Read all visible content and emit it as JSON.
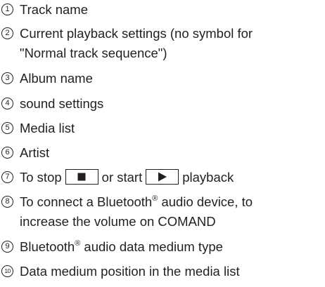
{
  "items": [
    {
      "number": "1",
      "text": "Track name"
    },
    {
      "number": "2",
      "line1": "Current playback settings (no symbol for",
      "line2": "\"Normal track sequence\")"
    },
    {
      "number": "3",
      "text": "Album name"
    },
    {
      "number": "4",
      "text": "sound settings"
    },
    {
      "number": "5",
      "text": "Media list"
    },
    {
      "number": "6",
      "text": "Artist"
    },
    {
      "number": "7",
      "part1": "To stop",
      "part2": "or start",
      "part3": "playback",
      "stop_icon": "stop-square-icon",
      "play_icon": "play-triangle-icon"
    },
    {
      "number": "8",
      "line1_a": "To connect a Bluetooth",
      "registered": "®",
      "line1_b": " audio device, to",
      "line2": "increase the volume on COMAND"
    },
    {
      "number": "9",
      "text_a": "Bluetooth",
      "registered": "®",
      "text_b": " audio data medium type"
    },
    {
      "number": "10",
      "text": "Data medium position in the media list"
    }
  ]
}
